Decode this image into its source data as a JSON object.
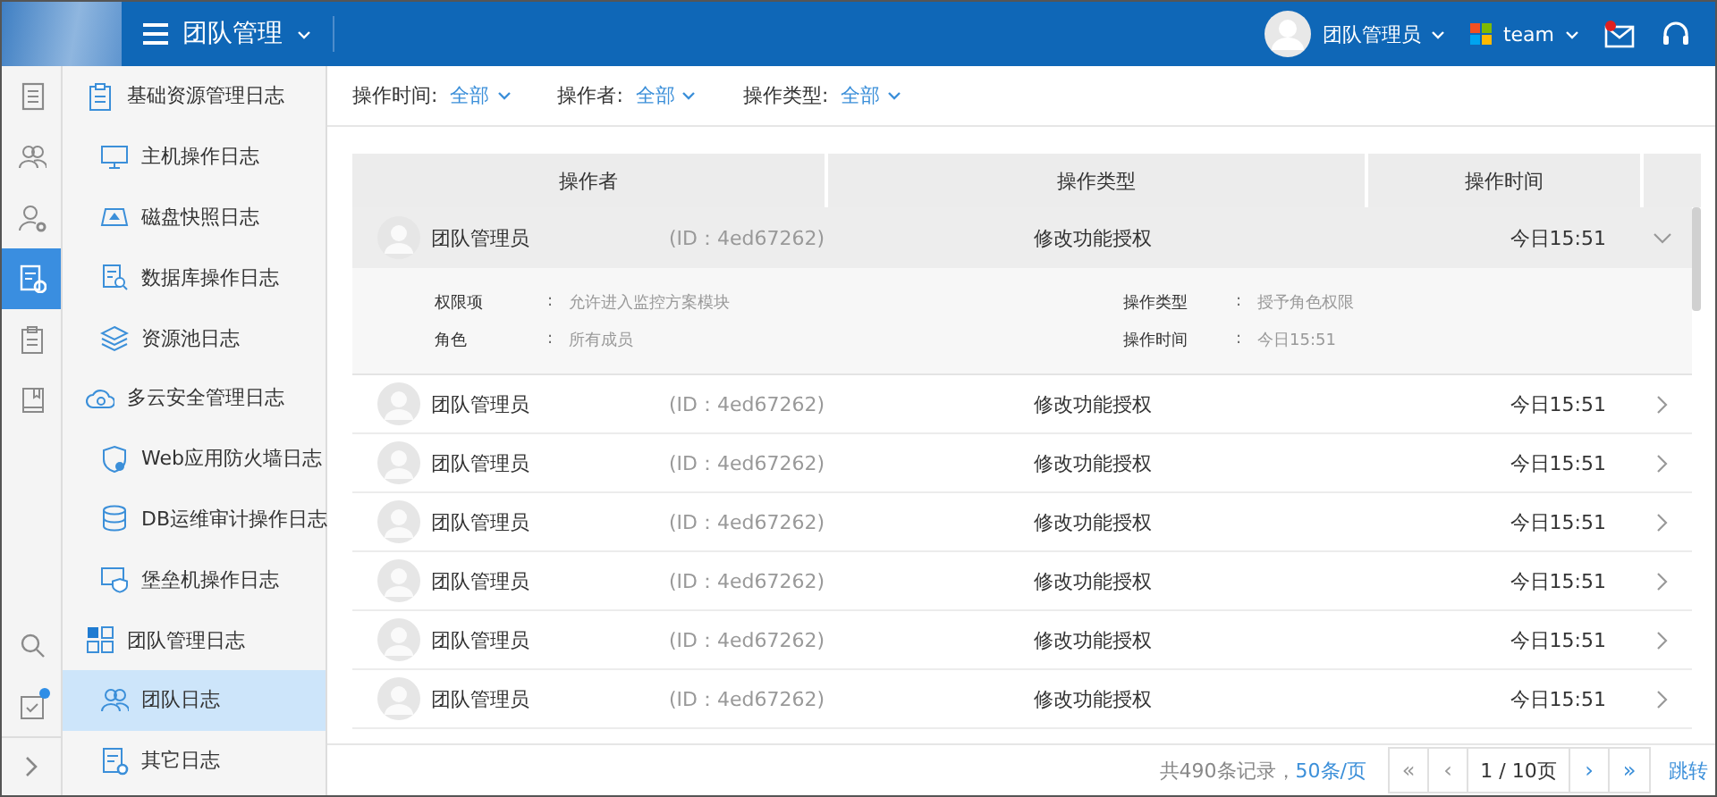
{
  "header": {
    "title": "团队管理",
    "user": "团队管理员",
    "team": "team",
    "mail_unread": true
  },
  "rail": [
    {
      "selected": false
    },
    {
      "selected": false
    },
    {
      "selected": false
    },
    {
      "selected": true
    },
    {
      "selected": false
    },
    {
      "selected": false
    },
    {
      "selected": false
    },
    {
      "selected": false,
      "badge": true
    }
  ],
  "sidebar": {
    "groups": [
      {
        "label": "基础资源管理日志",
        "selected": false,
        "children": [
          {
            "label": "主机操作日志",
            "selected": false
          },
          {
            "label": "磁盘快照日志",
            "selected": false
          },
          {
            "label": "数据库操作日志",
            "selected": false
          },
          {
            "label": "资源池日志",
            "selected": false
          }
        ]
      },
      {
        "label": "多云安全管理日志",
        "selected": false,
        "children": [
          {
            "label": "Web应用防火墙日志",
            "selected": false
          },
          {
            "label": "DB运维审计操作日志",
            "selected": false
          },
          {
            "label": "堡垒机操作日志",
            "selected": false
          }
        ]
      },
      {
        "label": "团队管理日志",
        "selected": false,
        "children": [
          {
            "label": "团队日志",
            "selected": true
          },
          {
            "label": "其它日志",
            "selected": false
          }
        ]
      }
    ]
  },
  "filters": [
    {
      "label": "操作时间:",
      "value": "全部"
    },
    {
      "label": "操作者:",
      "value": "全部"
    },
    {
      "label": "操作类型:",
      "value": "全部"
    }
  ],
  "table": {
    "columns": [
      "操作者",
      "操作类型",
      "操作时间"
    ],
    "rows": [
      {
        "name": "团队管理员",
        "id": "(ID：4ed67262)",
        "type": "修改功能授权",
        "time": "今日15:51",
        "expanded": true,
        "details": [
          {
            "label": "权限项",
            "separator": ":",
            "value": "允许进入监控方案模块"
          },
          {
            "label": "操作类型",
            "separator": ":",
            "value": "授予角色权限"
          },
          {
            "label": "角色",
            "separator": ":",
            "value": "所有成员"
          },
          {
            "label": "操作时间",
            "separator": ":",
            "value": "今日15:51"
          }
        ]
      },
      {
        "name": "团队管理员",
        "id": "(ID：4ed67262)",
        "type": "修改功能授权",
        "time": "今日15:51",
        "expanded": false
      },
      {
        "name": "团队管理员",
        "id": "(ID：4ed67262)",
        "type": "修改功能授权",
        "time": "今日15:51",
        "expanded": false
      },
      {
        "name": "团队管理员",
        "id": "(ID：4ed67262)",
        "type": "修改功能授权",
        "time": "今日15:51",
        "expanded": false
      },
      {
        "name": "团队管理员",
        "id": "(ID：4ed67262)",
        "type": "修改功能授权",
        "time": "今日15:51",
        "expanded": false
      },
      {
        "name": "团队管理员",
        "id": "(ID：4ed67262)",
        "type": "修改功能授权",
        "time": "今日15:51",
        "expanded": false
      },
      {
        "name": "团队管理员",
        "id": "(ID：4ed67262)",
        "type": "修改功能授权",
        "time": "今日15:51",
        "expanded": false
      }
    ]
  },
  "pagination": {
    "total": "共490条记录，",
    "per_page": "50条/页",
    "first": "«",
    "prev": "‹",
    "page": "1 / 10页",
    "next": "›",
    "last": "»",
    "jump": "跳转"
  }
}
